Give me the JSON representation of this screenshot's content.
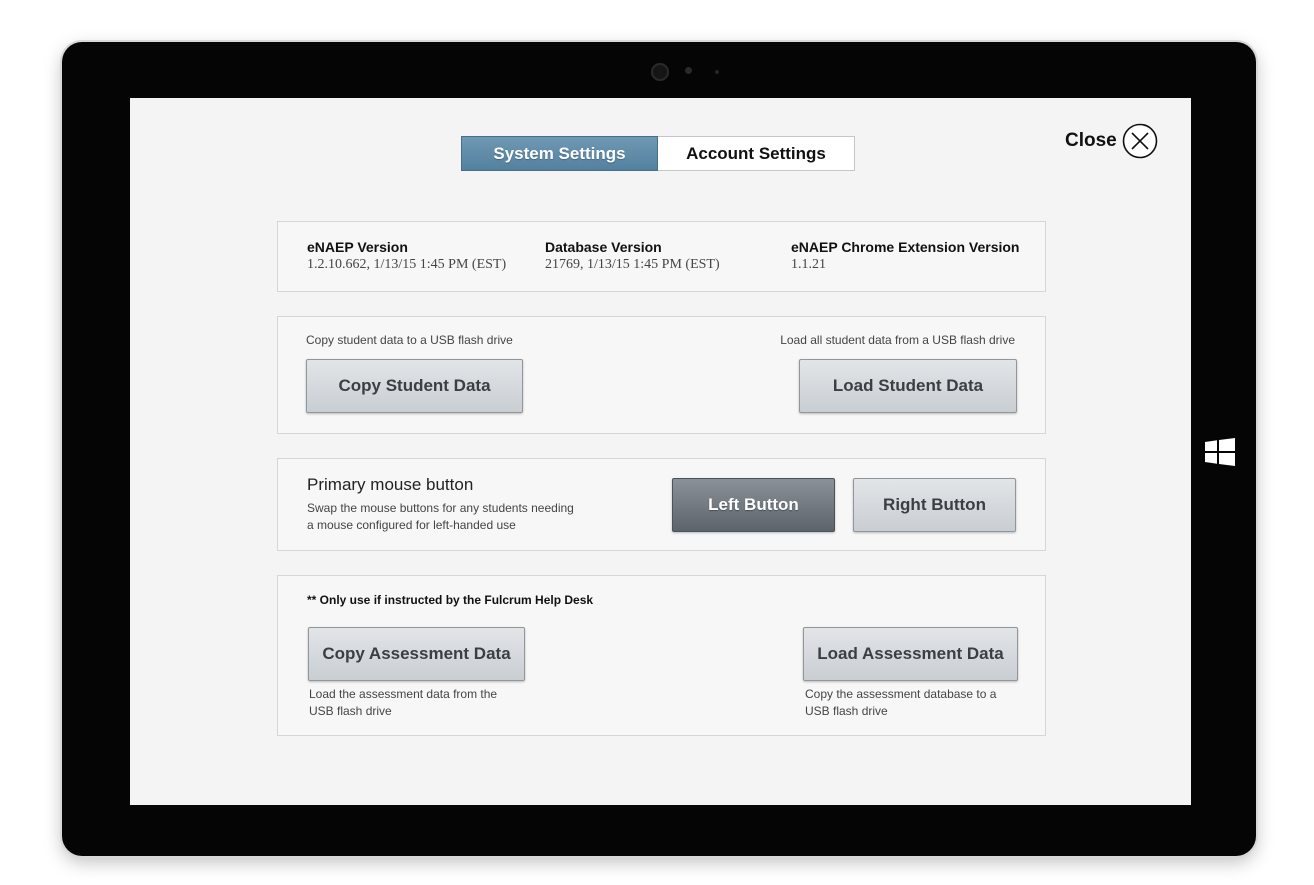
{
  "tabs": {
    "system_settings": "System Settings",
    "account_settings": "Account Settings"
  },
  "close": {
    "label": "Close"
  },
  "versions": {
    "enaep": {
      "title": "eNAEP Version",
      "value": "1.2.10.662, 1/13/15 1:45 PM (EST)"
    },
    "database": {
      "title": "Database Version",
      "value": "21769, 1/13/15 1:45 PM (EST)"
    },
    "chrome_ext": {
      "title": "eNAEP Chrome Extension Version",
      "value": "1.1.21"
    }
  },
  "student_data": {
    "copy_description": "Copy student data to a USB flash drive",
    "copy_button": "Copy Student Data",
    "load_description": "Load all student data from a USB flash drive",
    "load_button": "Load Student Data"
  },
  "mouse": {
    "title": "Primary mouse button",
    "description_line1": "Swap the mouse buttons for any students needing",
    "description_line2": "a mouse configured for left-handed use",
    "left_button": "Left Button",
    "right_button": "Right Button"
  },
  "assessment": {
    "warning": "** Only use if instructed by the Fulcrum Help Desk",
    "copy_button": "Copy Assessment Data",
    "copy_description_line1": "Load the assessment data from the",
    "copy_description_line2": "USB flash drive",
    "load_button": "Load Assessment Data",
    "load_description_line1": "Copy the assessment database to a",
    "load_description_line2": "USB flash drive"
  },
  "colors": {
    "active_tab": "#5f8ca9",
    "active_button": "#6c747a",
    "button": "#d3d7db"
  }
}
